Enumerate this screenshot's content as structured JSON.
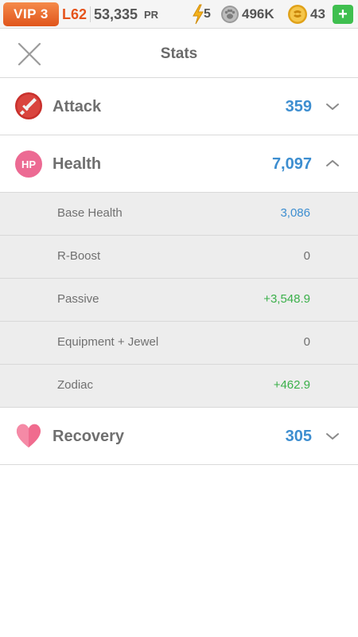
{
  "topbar": {
    "vip": "VIP 3",
    "level": "L62",
    "power_value": "53,335",
    "power_label": "PR",
    "energy": "5",
    "coins": "496K",
    "gems": "43",
    "add_label": "+",
    "icons": [
      "lightning-icon",
      "coin-paw-icon",
      "gem-coin-icon"
    ]
  },
  "header": {
    "title": "Stats",
    "close_icon": "close-icon"
  },
  "stats": {
    "attack": {
      "label": "Attack",
      "value": "359",
      "icon": "sword-icon",
      "expanded": false
    },
    "health": {
      "label": "Health",
      "value": "7,097",
      "icon": "hp-icon",
      "icon_text": "HP",
      "expanded": true
    },
    "recovery": {
      "label": "Recovery",
      "value": "305",
      "icon": "heart-icon",
      "expanded": false
    }
  },
  "health_breakdown": [
    {
      "label": "Base Health",
      "value": "3,086"
    },
    {
      "label": "R-Boost",
      "value": "0"
    },
    {
      "label": "Passive",
      "value": "+3,548.9"
    },
    {
      "label": "Equipment + Jewel",
      "value": "0"
    },
    {
      "label": "Zodiac",
      "value": "+462.9"
    }
  ],
  "colors": {
    "value_blue": "#3d8ed0",
    "bonus_green": "#3bb04a",
    "vip_orange": "#e5531c",
    "add_green": "#3fbf4f"
  }
}
